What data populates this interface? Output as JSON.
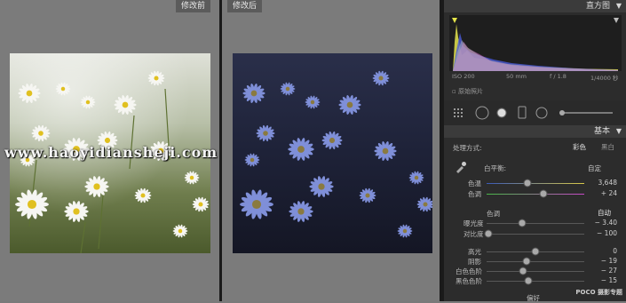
{
  "view": {
    "before_label": "修改前",
    "after_label": "修改后",
    "watermark": "www.haoyidiansheji.com"
  },
  "panel": {
    "histogram": {
      "title": "直方图",
      "iso": "ISO 200",
      "focal": "50 mm",
      "aperture": "f / 1.8",
      "shutter": "1/4000 秒",
      "original_photo_label": "原始照片"
    },
    "basic": {
      "title": "基本",
      "treatment_label": "处理方式:",
      "treatment_color": "彩色",
      "treatment_bw": "黑白",
      "wb_label": "白平衡:",
      "wb_value": "自定",
      "temp_label": "色温",
      "temp_value": "3,648",
      "temp_position": 0.42,
      "tint_label": "色调",
      "tint_value": "+ 24",
      "tint_position": 0.58,
      "tone_label": "色调",
      "tone_auto": "自动",
      "exposure_label": "曝光度",
      "exposure_value": "− 3.40",
      "exposure_position": 0.36,
      "contrast_label": "对比度",
      "contrast_value": "− 100",
      "contrast_position": 0.02,
      "highlights_label": "高光",
      "highlights_value": "0",
      "highlights_position": 0.5,
      "shadows_label": "阴影",
      "shadows_value": "− 19",
      "shadows_position": 0.41,
      "whites_label": "白色色阶",
      "whites_value": "− 27",
      "whites_position": 0.37,
      "blacks_label": "黑色色阶",
      "blacks_value": "− 15",
      "blacks_position": 0.43,
      "presence_label": "偏好"
    },
    "logo": "POCO 摄影专题"
  },
  "colors": {
    "panel_bg": "#2c2c2c",
    "pane_bg": "#7b7b7b",
    "divider": "#1a1a1a"
  }
}
